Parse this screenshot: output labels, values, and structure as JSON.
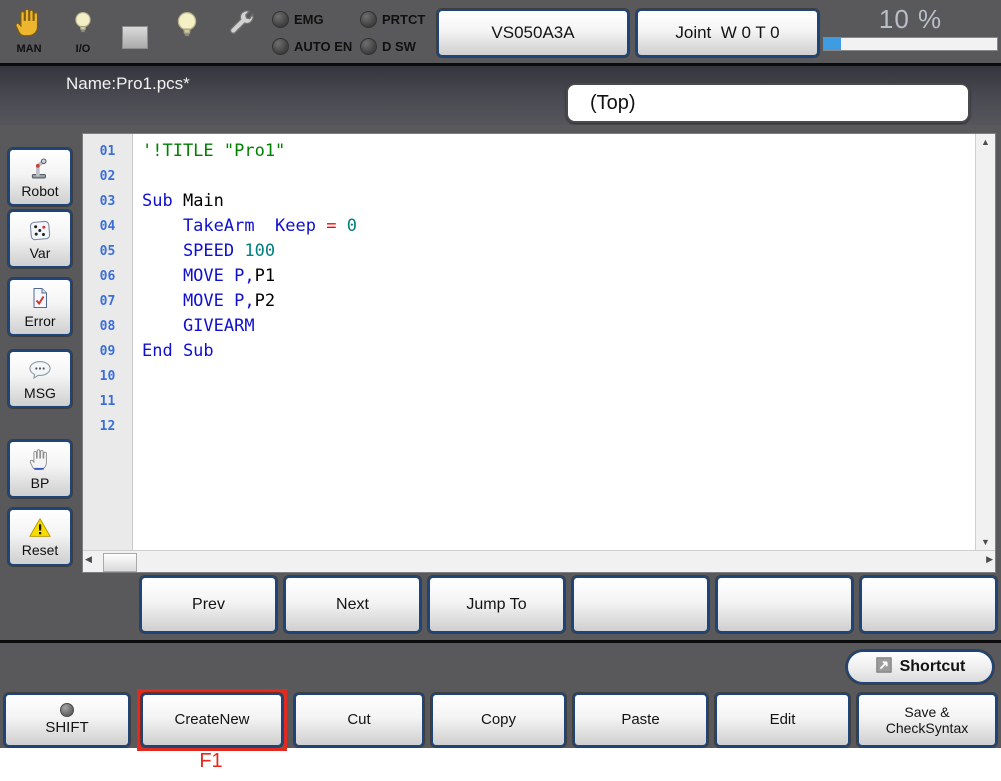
{
  "toolbar": {
    "man_label": "MAN",
    "io_label": "I/O",
    "indicators": [
      {
        "label": "EMG"
      },
      {
        "label": "PRTCT"
      },
      {
        "label": "AUTO EN"
      },
      {
        "label": "D SW"
      }
    ],
    "robot_model_button": "VS050A3A",
    "joint_mode_button": "Joint  W 0 T 0",
    "speed_text": "10 %",
    "speed_percent": 10
  },
  "titlebar": {
    "program_name": "Name:Pro1.pcs*",
    "scope_box": "(Top)"
  },
  "sidebar": {
    "buttons": [
      {
        "label": "Robot",
        "icon": "robot-arm-icon"
      },
      {
        "label": "Var",
        "icon": "dice-icon"
      },
      {
        "label": "Error",
        "icon": "error-document-icon"
      },
      {
        "label": "MSG",
        "icon": "message-bubble-icon"
      },
      {
        "label": "BP",
        "icon": "hand-icon"
      },
      {
        "label": "Reset",
        "icon": "warning-triangle-icon"
      }
    ]
  },
  "editor": {
    "syntax_colors": {
      "comment": "#008000",
      "keyword": "#0f0fd0",
      "plain": "#000000",
      "operator": "#ff0000",
      "number": "#008080"
    },
    "lines": [
      {
        "num": "01",
        "segments": [
          {
            "text": "'!TITLE \"Pro1\"",
            "color": "comment"
          }
        ]
      },
      {
        "num": "02",
        "segments": []
      },
      {
        "num": "03",
        "segments": [
          {
            "text": "Sub ",
            "color": "keyword"
          },
          {
            "text": "Main",
            "color": "plain"
          }
        ]
      },
      {
        "num": "04",
        "segments": [
          {
            "text": "    TakeArm  Keep ",
            "color": "keyword"
          },
          {
            "text": "= ",
            "color": "operator"
          },
          {
            "text": "0",
            "color": "number"
          }
        ]
      },
      {
        "num": "05",
        "segments": [
          {
            "text": "    SPEED ",
            "color": "keyword"
          },
          {
            "text": "100",
            "color": "number"
          }
        ]
      },
      {
        "num": "06",
        "segments": [
          {
            "text": "    MOVE P,",
            "color": "keyword"
          },
          {
            "text": "P1",
            "color": "plain"
          }
        ]
      },
      {
        "num": "07",
        "segments": [
          {
            "text": "    MOVE P,",
            "color": "keyword"
          },
          {
            "text": "P2",
            "color": "plain"
          }
        ]
      },
      {
        "num": "08",
        "segments": [
          {
            "text": "    GIVEARM",
            "color": "keyword"
          }
        ]
      },
      {
        "num": "09",
        "segments": [
          {
            "text": "End Sub",
            "color": "keyword"
          }
        ]
      },
      {
        "num": "10",
        "segments": []
      },
      {
        "num": "11",
        "segments": []
      },
      {
        "num": "12",
        "segments": []
      }
    ]
  },
  "nav_buttons": [
    {
      "label": "Prev"
    },
    {
      "label": "Next"
    },
    {
      "label": "Jump To"
    },
    {
      "label": ""
    },
    {
      "label": ""
    },
    {
      "label": ""
    }
  ],
  "shortcut": {
    "label": "Shortcut"
  },
  "function_row": {
    "buttons": [
      {
        "label": "SHIFT",
        "has_led": true
      },
      {
        "label": "CreateNew",
        "highlighted": true
      },
      {
        "label": "Cut"
      },
      {
        "label": "Copy"
      },
      {
        "label": "Paste"
      },
      {
        "label": "Edit"
      },
      {
        "label": "Save &",
        "label2": "CheckSyntax"
      }
    ],
    "fkey_label": "F1"
  },
  "colors": {
    "panel_gray": "#59595c",
    "button_border_blue": "#1d4579",
    "highlight_red": "#e02b20",
    "progress_blue": "#3f9ce0",
    "line_number_blue": "#3a6fd8"
  }
}
